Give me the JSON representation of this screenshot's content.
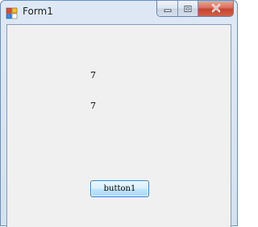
{
  "window": {
    "title": "Form1"
  },
  "labels": {
    "label1": "7",
    "label2": "7"
  },
  "buttons": {
    "button1": "button1"
  },
  "icons": {
    "app": "form-app-icon",
    "minimize": "minimize-icon",
    "maximize": "maximize-icon",
    "close": "close-icon"
  },
  "colors": {
    "client_bg": "#f0f0f0",
    "close_button": "#c4452e",
    "button_border": "#3c7fb1"
  }
}
